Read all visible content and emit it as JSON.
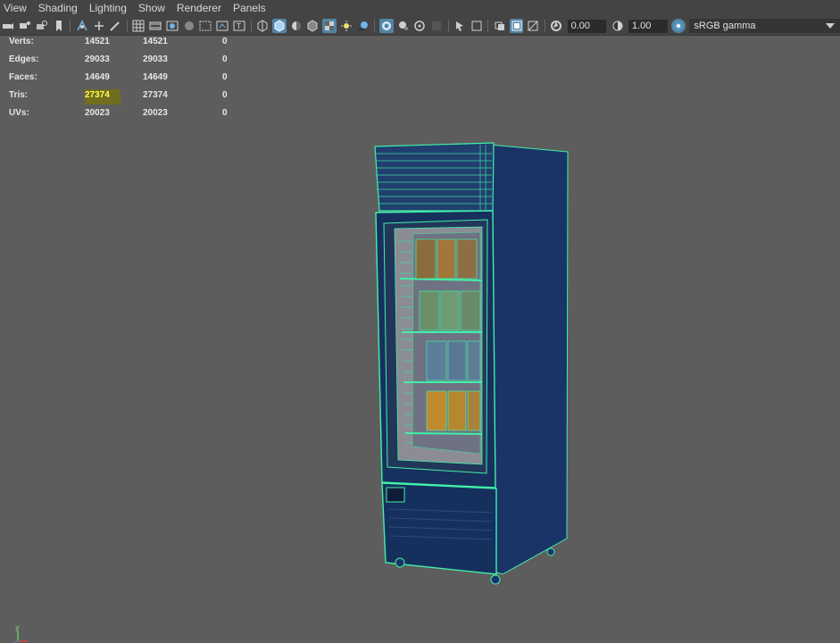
{
  "menu": {
    "items": [
      "View",
      "Shading",
      "Lighting",
      "Show",
      "Renderer",
      "Panels"
    ]
  },
  "toolbar": {
    "exposure_value": "0.00",
    "gamma_value": "1.00",
    "color_space": "sRGB gamma"
  },
  "hud": {
    "rows": [
      {
        "label": "Verts:",
        "c1": "14521",
        "c2": "14521",
        "c3": "0"
      },
      {
        "label": "Edges:",
        "c1": "29033",
        "c2": "29033",
        "c3": "0"
      },
      {
        "label": "Faces:",
        "c1": "14649",
        "c2": "14649",
        "c3": "0"
      },
      {
        "label": "Tris:",
        "c1": "27374",
        "c2": "27374",
        "c3": "0"
      },
      {
        "label": "UVs:",
        "c1": "20023",
        "c2": "20023",
        "c3": "0"
      }
    ]
  },
  "axis": {
    "y_label": "y"
  },
  "colors": {
    "viewport_bg": "#5d5d5d",
    "wire": "#41f0a8",
    "body": "#1b3a6b",
    "highlight": "#ffff52"
  }
}
